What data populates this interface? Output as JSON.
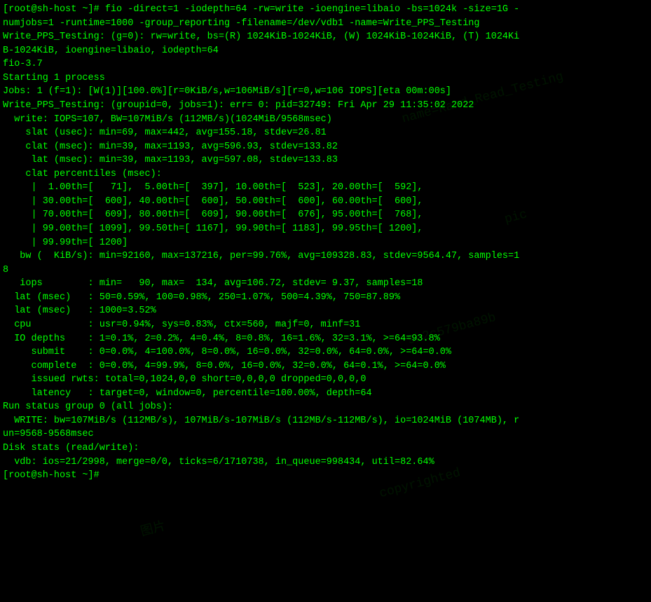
{
  "terminal": {
    "lines": [
      {
        "id": "l1",
        "text": "[root@sh-host ~]# fio -direct=1 -iodepth=64 -rw=write -ioengine=libaio -bs=1024k -size=1G -"
      },
      {
        "id": "l2",
        "text": "numjobs=1 -runtime=1000 -group_reporting -filename=/dev/vdb1 -name=Write_PPS_Testing"
      },
      {
        "id": "l3",
        "text": "Write_PPS_Testing: (g=0): rw=write, bs=(R) 1024KiB-1024KiB, (W) 1024KiB-1024KiB, (T) 1024Ki"
      },
      {
        "id": "l4",
        "text": "B-1024KiB, ioengine=libaio, iodepth=64"
      },
      {
        "id": "l5",
        "text": "fio-3.7"
      },
      {
        "id": "l6",
        "text": "Starting 1 process"
      },
      {
        "id": "l7",
        "text": "Jobs: 1 (f=1): [W(1)][100.0%][r=0KiB/s,w=106MiB/s][r=0,w=106 IOPS][eta 00m:00s]"
      },
      {
        "id": "l8",
        "text": "Write_PPS_Testing: (groupid=0, jobs=1): err= 0: pid=32749: Fri Apr 29 11:35:02 2022"
      },
      {
        "id": "l9",
        "text": "  write: IOPS=107, BW=107MiB/s (112MB/s)(1024MiB/9568msec)"
      },
      {
        "id": "l10",
        "text": "    slat (usec): min=69, max=442, avg=155.18, stdev=26.81"
      },
      {
        "id": "l11",
        "text": "    clat (msec): min=39, max=1193, avg=596.93, stdev=133.82"
      },
      {
        "id": "l12",
        "text": "     lat (msec): min=39, max=1193, avg=597.08, stdev=133.83"
      },
      {
        "id": "l13",
        "text": "    clat percentiles (msec):"
      },
      {
        "id": "l14",
        "text": "     |  1.00th=[   71],  5.00th=[  397], 10.00th=[  523], 20.00th=[  592],"
      },
      {
        "id": "l15",
        "text": "     | 30.00th=[  600], 40.00th=[  600], 50.00th=[  600], 60.00th=[  600],"
      },
      {
        "id": "l16",
        "text": "     | 70.00th=[  609], 80.00th=[  609], 90.00th=[  676], 95.00th=[  768],"
      },
      {
        "id": "l17",
        "text": "     | 99.00th=[ 1099], 99.50th=[ 1167], 99.90th=[ 1183], 99.95th=[ 1200],"
      },
      {
        "id": "l18",
        "text": "     | 99.99th=[ 1200]"
      },
      {
        "id": "l19",
        "text": "   bw (  KiB/s): min=92160, max=137216, per=99.76%, avg=109328.83, stdev=9564.47, samples=1"
      },
      {
        "id": "l20",
        "text": "8"
      },
      {
        "id": "l21",
        "text": "   iops        : min=   90, max=  134, avg=106.72, stdev= 9.37, samples=18"
      },
      {
        "id": "l22",
        "text": "  lat (msec)   : 50=0.59%, 100=0.98%, 250=1.07%, 500=4.39%, 750=87.89%"
      },
      {
        "id": "l23",
        "text": "  lat (msec)   : 1000=3.52%"
      },
      {
        "id": "l24",
        "text": "  cpu          : usr=0.94%, sys=0.83%, ctx=560, majf=0, minf=31"
      },
      {
        "id": "l25",
        "text": "  IO depths    : 1=0.1%, 2=0.2%, 4=0.4%, 8=0.8%, 16=1.6%, 32=3.1%, >=64=93.8%"
      },
      {
        "id": "l26",
        "text": "     submit    : 0=0.0%, 4=100.0%, 8=0.0%, 16=0.0%, 32=0.0%, 64=0.0%, >=64=0.0%"
      },
      {
        "id": "l27",
        "text": "     complete  : 0=0.0%, 4=99.9%, 8=0.0%, 16=0.0%, 32=0.0%, 64=0.1%, >=64=0.0%"
      },
      {
        "id": "l28",
        "text": "     issued rwts: total=0,1024,0,0 short=0,0,0,0 dropped=0,0,0,0"
      },
      {
        "id": "l29",
        "text": "     latency   : target=0, window=0, percentile=100.00%, depth=64"
      },
      {
        "id": "l30",
        "text": ""
      },
      {
        "id": "l31",
        "text": "Run status group 0 (all jobs):"
      },
      {
        "id": "l32",
        "text": "  WRITE: bw=107MiB/s (112MB/s), 107MiB/s-107MiB/s (112MB/s-112MB/s), io=1024MiB (1074MB), r"
      },
      {
        "id": "l33",
        "text": "un=9568-9568msec"
      },
      {
        "id": "l34",
        "text": ""
      },
      {
        "id": "l35",
        "text": "Disk stats (read/write):"
      },
      {
        "id": "l36",
        "text": "  vdb: ios=21/2998, merge=0/0, ticks=6/1710738, in_queue=998434, util=82.64%"
      },
      {
        "id": "l37",
        "text": "[root@sh-host ~]#"
      }
    ],
    "watermarks": [
      {
        "id": "wm1",
        "text": "name=Rand_Read_Testing",
        "class": "wm1"
      },
      {
        "id": "wm2",
        "text": "pic",
        "class": "wm2"
      },
      {
        "id": "wm3",
        "text": "9b2c579ba89b",
        "class": "wm3"
      },
      {
        "id": "wm4",
        "text": "copyrighted",
        "class": "wm4"
      },
      {
        "id": "wm5",
        "text": "图片",
        "class": "wm5"
      }
    ]
  }
}
